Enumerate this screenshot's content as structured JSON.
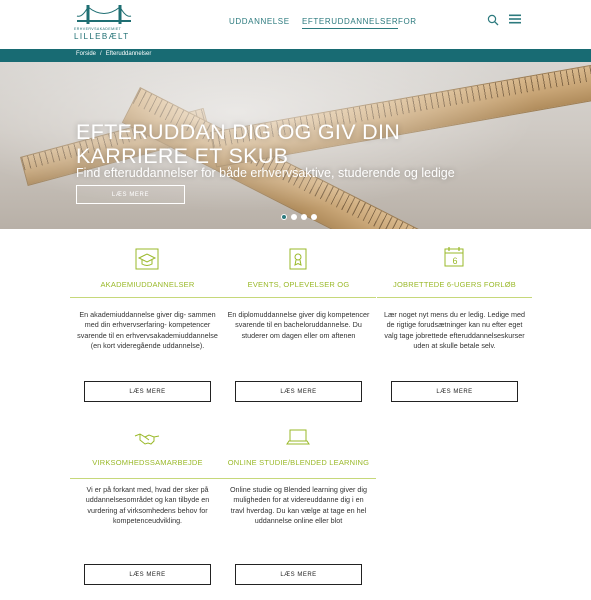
{
  "header": {
    "logo": {
      "small_text": "ERHVERVSAKADEMIET",
      "big_text": "LILLEBÆLT"
    },
    "nav": [
      {
        "label": "UDDANNELSE"
      },
      {
        "label": "EFTERUDDANNELSER"
      },
      {
        "label": "FOR"
      }
    ],
    "icons": {
      "search": "search-icon",
      "menu": "menu-icon"
    }
  },
  "breadcrumb": {
    "home": "Forside",
    "separator": "/",
    "current": "Efteruddannelser"
  },
  "hero": {
    "title": "EFTERUDDAN DIG OG GIV DIN KARRIERE ET SKUB",
    "subtitle": "Find efteruddannelser for både erhvervsaktive, studerende og ledige",
    "button": "LÆS MERE",
    "slides": 4,
    "active_slide": 1
  },
  "colors": {
    "primary": "#186b73",
    "accent": "#9ab929",
    "accent_line": "#c6d87a"
  },
  "cards": [
    {
      "icon": "graduation-cap-icon",
      "title": "AKADEMIUDDANNELSER",
      "text": "En akademiuddannelse giver dig- sammen med din erhvervserfaring- kompetencer svarende til en erhvervsakademiuddannelse (en kort videregående uddannelse).",
      "button": "LÆS MERE"
    },
    {
      "icon": "certificate-icon",
      "title": "EVENTS, OPLEVELSER OG",
      "text": "En diplomuddannelse giver dig kompetencer svarende til en bacheloruddannelse. Du studerer om dagen eller om aftenen",
      "button": "LÆS MERE"
    },
    {
      "icon": "calendar-icon",
      "title": "JOBRETTEDE 6-UGERS FORLØB",
      "text": "Lær noget nyt mens du er ledig. Ledige med de rigtige forudsætninger kan nu efter eget valg tage jobrettede efteruddannelseskurser uden at skulle betale selv.",
      "button": "LÆS MERE",
      "icon_label": "6"
    },
    {
      "icon": "handshake-icon",
      "title": "VIRKSOMHEDSSAMARBEJDE",
      "text": "Vi er på forkant med, hvad der sker på uddannelsesområdet og kan tilbyde en vurdering af virksomhedens behov for kompetenceudvikling.",
      "button": "LÆS MERE"
    },
    {
      "icon": "laptop-icon",
      "title": "ONLINE STUDIE/BLENDED LEARNING",
      "text": "Online studie og Blended learning giver dig muligheden for at videreuddanne dig i en travl hverdag. Du kan vælge at tage en hel uddannelse online eller blot",
      "button": "LÆS MERE"
    }
  ]
}
